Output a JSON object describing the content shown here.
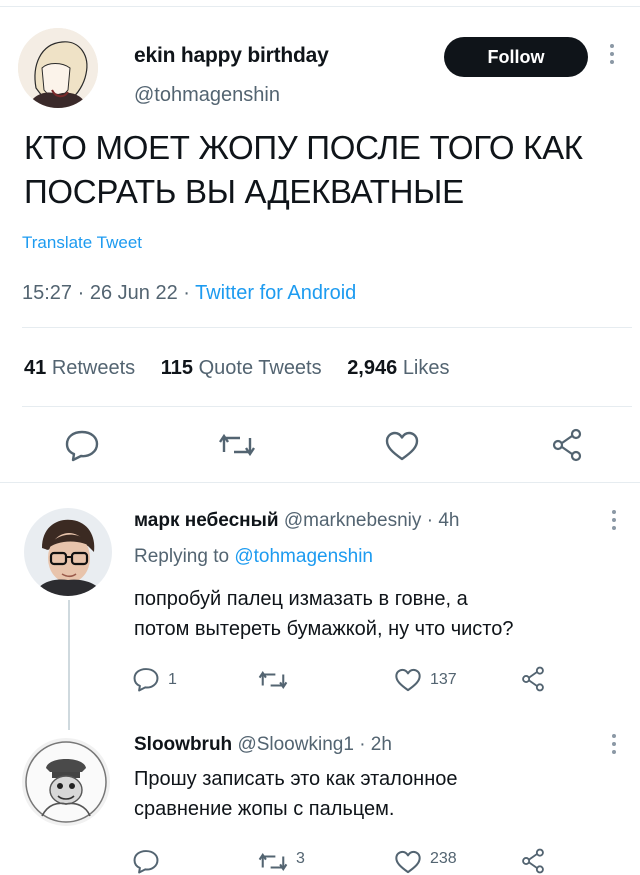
{
  "tweet": {
    "author_name": "ekin happy birthday",
    "author_handle": "@tohmagenshin",
    "follow_label": "Follow",
    "text_line1": "КТО МОЕТ ЖОПУ ПОСЛЕ ТОГО КАК",
    "text_line2": "ПОСРАТЬ ВЫ АДЕКВАТНЫЕ",
    "translate_label": "Translate Tweet",
    "time": "15:27",
    "date": "26 Jun 22",
    "source": "Twitter for Android",
    "retweets_count": "41",
    "retweets_label": "Retweets",
    "quotes_count": "115",
    "quotes_label": "Quote Tweets",
    "likes_count": "2,946",
    "likes_label": "Likes"
  },
  "replies": [
    {
      "name": "марк небесный",
      "handle": "@marknebesniy",
      "age": "4h",
      "replying_prefix": "Replying to",
      "replying_handle": "@tohmagenshin",
      "line1": "попробуй палец измазать в говне, а",
      "line2": "потом вытереть бумажкой, ну что чисто?",
      "reply_count": "1",
      "like_count": "137"
    },
    {
      "name": "Sloowbruh",
      "handle": "@Sloowking1",
      "age": "2h",
      "line1": "Прошу записать это как эталонное",
      "line2": "сравнение жопы с пальцем.",
      "retweet_count": "3",
      "like_count": "238"
    }
  ],
  "icons": [
    "reply-icon",
    "retweet-icon",
    "like-icon",
    "share-icon",
    "more-icon"
  ],
  "colors": {
    "accent": "#1d9bf0",
    "text": "#0f1419",
    "muted": "#536471",
    "border": "#e6ecf0"
  }
}
